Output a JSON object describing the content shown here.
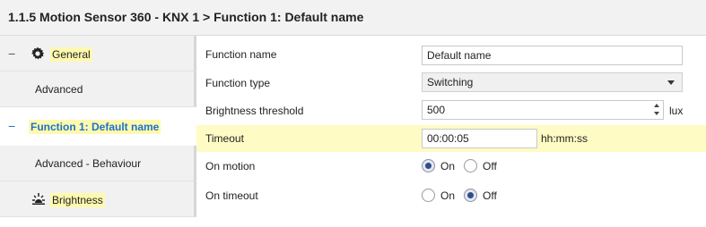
{
  "header": {
    "title": "1.1.5 Motion Sensor 360 - KNX 1 > Function 1: Default name"
  },
  "sidebar": {
    "items": [
      {
        "label": "General",
        "collapse": "−",
        "icon": "gear-icon"
      },
      {
        "label": "Advanced"
      },
      {
        "label": "Function 1: Default name",
        "collapse": "−",
        "active": true
      },
      {
        "label": "Advanced - Behaviour"
      },
      {
        "label": "Brightness",
        "icon": "brightness-icon"
      }
    ]
  },
  "form": {
    "function_name": {
      "label": "Function name",
      "value": "Default name"
    },
    "function_type": {
      "label": "Function type",
      "value": "Switching"
    },
    "brightness_threshold": {
      "label": "Brightness threshold",
      "value": "500",
      "unit": "lux"
    },
    "timeout": {
      "label": "Timeout",
      "value": "00:00:05",
      "unit": "hh:mm:ss"
    },
    "on_motion": {
      "label": "On motion",
      "options": [
        "On",
        "Off"
      ],
      "selected": "On"
    },
    "on_timeout": {
      "label": "On timeout",
      "options": [
        "On",
        "Off"
      ],
      "selected": "Off"
    }
  },
  "colors": {
    "accent": "#1a73c8",
    "highlight": "#fffbc4"
  }
}
